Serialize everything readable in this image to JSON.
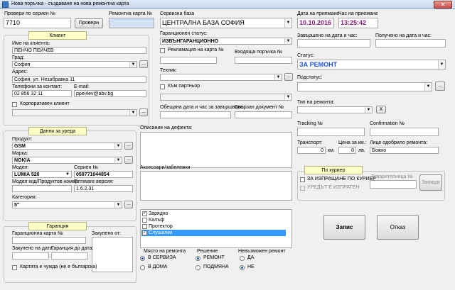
{
  "window": {
    "title": "Нова поръчка - създаване на нова ремонтна карта",
    "close": "✕"
  },
  "top": {
    "check_serial_label": "Провери по сериен №",
    "check_serial_value": "7710",
    "check_button": "Провери",
    "repair_card_label": "Ремонтна карта №",
    "service_base_label": "Сервизна база",
    "service_base_value": "ЦЕНТРАЛНА БАЗА СОФИЯ",
    "receive_date_label": "Дата на приемане",
    "receive_date_value": "10.10.2016",
    "receive_time_label": "Час на приемане",
    "receive_time_value": "13:25:42"
  },
  "client": {
    "header": "Клиент",
    "name_label": "Име на клиента:",
    "name_value": "ПЕНЧО ПЕЙЧЕВ",
    "city_label": "Град:",
    "city_value": "София",
    "address_label": "Адрес:",
    "address_value": "София, ул. Незабравка 11",
    "phone_label": "Телефони за контакт:",
    "phone_value": "02 856 32 11",
    "email_label": "E-mail:",
    "email_value": "ppei4ev@abv.bg",
    "corporate_label": "Корпоративен клиент"
  },
  "device": {
    "header": "Данни за уреда",
    "product_label": "Продукт:",
    "product_value": "GSM",
    "brand_label": "Марка:",
    "brand_value": "NOKIA",
    "model_label": "Модел:",
    "model_value": "LUMIA 520",
    "serial_label": "Сериен №",
    "serial_value": "059771044854",
    "model_code_label": "Модел код/Продуктов номер:",
    "firmware_label": "Firmware версия:",
    "firmware_value": "1.6.2.31",
    "category_label": "Категория:",
    "category_value": "5\""
  },
  "warranty": {
    "header": "Гаранция",
    "card_label": "Гаранционна карта №",
    "bought_from_label": "Закупено от:",
    "bought_date_label": "Закупено на дата:",
    "warranty_until_label": "Гаранция до дата:",
    "foreign_card_label": "Картата е чужда (не е българска)"
  },
  "middle": {
    "warranty_status_label": "Гаранционен статус:",
    "warranty_status_value": "ИЗВЪНГАРАНЦИОННО",
    "complaint_label": "Рекламация на карта №",
    "incoming_order_label": "Входяща поръчка №",
    "technician_label": "Техник:",
    "partner_label": "Към партньор",
    "promised_label": "Обещана дата и час за завършване:",
    "linked_doc_label": "Свързан документ №",
    "defect_label": "Описание на дефекта:",
    "accessories_label": "Аксесоари/забележки",
    "accessories": [
      {
        "label": "Зарядно",
        "checked": true,
        "selected": false,
        "mark": "✓"
      },
      {
        "label": "Калъф",
        "checked": false,
        "selected": false,
        "mark": ""
      },
      {
        "label": "Протектор",
        "checked": false,
        "selected": false,
        "mark": ""
      },
      {
        "label": "Слушалки",
        "checked": true,
        "selected": true,
        "mark": "✓"
      }
    ],
    "repair_place_label": "Място на ремонта",
    "repair_place_options": [
      "В СЕРВИЗА",
      "В ДОМА"
    ],
    "decision_label": "Решение",
    "decision_options": [
      "РЕМОНТ",
      "ПОДМЯНА"
    ],
    "impossible_label": "Невъзможен ремонт",
    "impossible_options": [
      "ДА",
      "НЕ"
    ]
  },
  "right": {
    "completed_label": "Завършено на дата и час:",
    "received_label": "Получено на дата и час:",
    "status_label": "Статус:",
    "status_value": "ЗА РЕМОНТ",
    "substatus_label": "Подстатус:",
    "repair_type_label": "Тип на ремонта:",
    "repair_type_x": "X",
    "tracking_label": "Tracking №",
    "confirmation_label": "Confirmation №",
    "transport_label": "Транспорт:",
    "transport_value": "0",
    "transport_unit": "км.",
    "price_km_label": "Цена за км.:",
    "price_km_value": "0",
    "price_km_unit": "лв.",
    "approved_label": "Лице одобрило ремонта:",
    "approved_value": "Божко",
    "courier_header": "По куриер",
    "courier_send_label": "ЗА ИЗПРАЩАНЕ ПО КУРИЕР",
    "courier_sent_label": "УРЕДЪТ Е ИЗПРАТЕН",
    "waybill_label": "Товарителница №",
    "record_small_button": "Запиши",
    "save_button": "Запис",
    "cancel_button": "Отказ"
  },
  "colors": {
    "status_text": "#1f55d8",
    "date_text": "#8b1a7a",
    "accent_header": "#ffffc8"
  }
}
